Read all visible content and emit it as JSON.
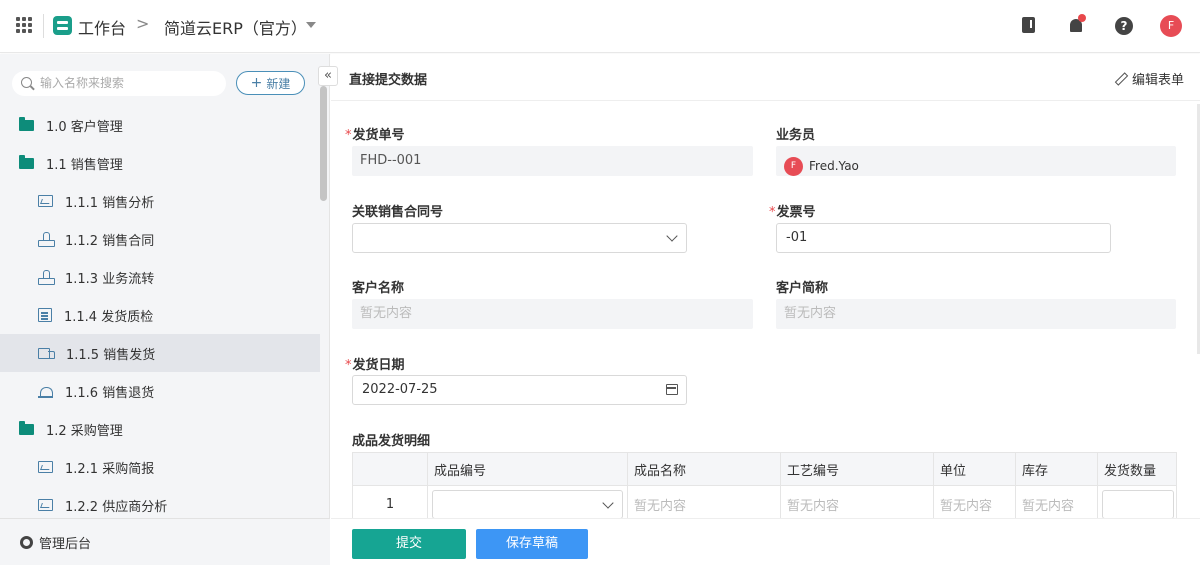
{
  "topbar": {
    "workbench": "工作台",
    "separator": ">",
    "app_name": "简道云ERP（官方）",
    "avatar_letter": "F"
  },
  "sidebar": {
    "search_placeholder": "输入名称来搜索",
    "new_label": "新建",
    "collapse_glyph": "«",
    "items": [
      {
        "label": "1.0 客户管理",
        "icon": "folder-icon",
        "level": 1
      },
      {
        "label": "1.1 销售管理",
        "icon": "folder-icon",
        "level": 1
      },
      {
        "label": "1.1.1 销售分析",
        "icon": "chart-icon",
        "level": 2
      },
      {
        "label": "1.1.2 销售合同",
        "icon": "stamp-icon",
        "level": 2
      },
      {
        "label": "1.1.3 业务流转",
        "icon": "stamp-icon",
        "level": 2
      },
      {
        "label": "1.1.4 发货质检",
        "icon": "doc-icon",
        "level": 2
      },
      {
        "label": "1.1.5 销售发货",
        "icon": "truck-icon",
        "level": 2,
        "active": true
      },
      {
        "label": "1.1.6 销售退货",
        "icon": "alarm-icon",
        "level": 2
      },
      {
        "label": "1.2 采购管理",
        "icon": "folder-icon",
        "level": 1
      },
      {
        "label": "1.2.1 采购简报",
        "icon": "chart-icon",
        "level": 2
      },
      {
        "label": "1.2.2 供应商分析",
        "icon": "chart-icon",
        "level": 2
      }
    ],
    "footer_label": "管理后台"
  },
  "main": {
    "title": "直接提交数据",
    "edit_label": "编辑表单",
    "fields": {
      "shipment_no": {
        "label": "发货单号",
        "required": "*",
        "value": "FHD--001"
      },
      "salesperson": {
        "label": "业务员",
        "value": "Fred.Yao",
        "avatar": "F"
      },
      "contract_no": {
        "label": "关联销售合同号",
        "value": ""
      },
      "invoice_no": {
        "label": "发票号",
        "required": "*",
        "value": "-01"
      },
      "customer_name": {
        "label": "客户名称",
        "value": "暂无内容"
      },
      "customer_short": {
        "label": "客户简称",
        "value": "暂无内容"
      },
      "ship_date": {
        "label": "发货日期",
        "required": "*",
        "value": "2022-07-25"
      }
    },
    "detail": {
      "label": "成品发货明细",
      "columns": [
        "",
        "成品编号",
        "成品名称",
        "工艺编号",
        "单位",
        "库存",
        "发货数量"
      ],
      "row": {
        "num": "1",
        "name": "暂无内容",
        "process": "暂无内容",
        "unit": "暂无内容",
        "stock": "暂无内容"
      }
    },
    "buttons": {
      "submit": "提交",
      "draft": "保存草稿"
    }
  },
  "colors": {
    "accent": "#16a593",
    "primary": "#3d96f5",
    "danger": "#e8484b"
  }
}
